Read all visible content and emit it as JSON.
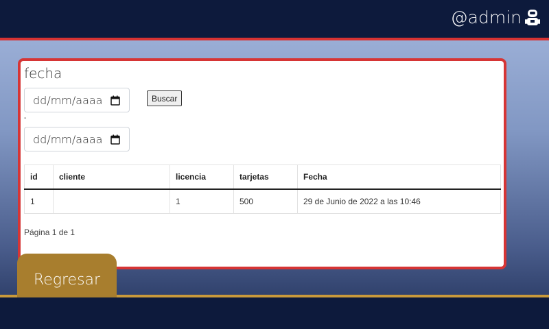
{
  "header": {
    "username": "@admin",
    "user_icon": "robot-user-icon"
  },
  "filter": {
    "title": "fecha",
    "date_from_placeholder": "dd/mm/aaaa",
    "date_to_placeholder": "dd/mm/aaaa",
    "separator": "-",
    "search_label": "Buscar"
  },
  "table": {
    "columns": [
      "id",
      "cliente",
      "licencia",
      "tarjetas",
      "Fecha"
    ],
    "rows": [
      [
        "1",
        "",
        "1",
        "500",
        "29 de Junio de 2022 a las 10:46"
      ]
    ]
  },
  "pagination": "Página 1 de 1",
  "back_label": "Regresar",
  "colors": {
    "navbar": "#0d1a3c",
    "accent_red": "#d63535",
    "button_gold": "#a87e2e"
  }
}
